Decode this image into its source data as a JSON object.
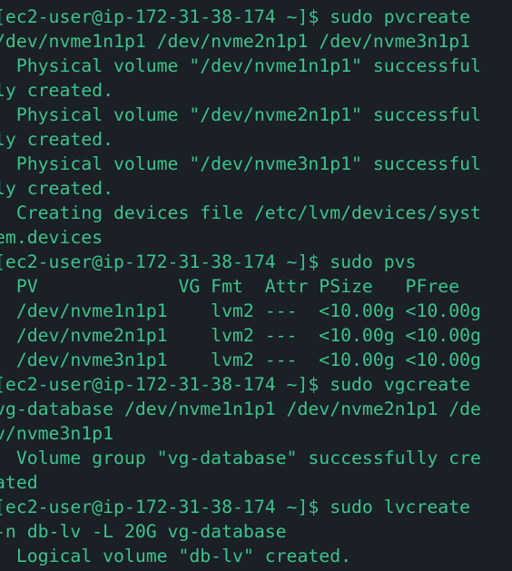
{
  "terminal": {
    "lines": [
      {
        "kind": "prompt",
        "text": "[ec2-user@ip-172-31-38-174 ~]$ sudo pvcreate"
      },
      {
        "kind": "continuation",
        "text": "/dev/nvme1n1p1 /dev/nvme2n1p1 /dev/nvme3n1p1"
      },
      {
        "kind": "output",
        "text": "  Physical volume \"/dev/nvme1n1p1\" successful"
      },
      {
        "kind": "continuation",
        "text": "ly created."
      },
      {
        "kind": "output",
        "text": "  Physical volume \"/dev/nvme2n1p1\" successful"
      },
      {
        "kind": "continuation",
        "text": "ly created."
      },
      {
        "kind": "output",
        "text": "  Physical volume \"/dev/nvme3n1p1\" successful"
      },
      {
        "kind": "continuation",
        "text": "ly created."
      },
      {
        "kind": "output",
        "text": "  Creating devices file /etc/lvm/devices/syst"
      },
      {
        "kind": "continuation",
        "text": "em.devices"
      },
      {
        "kind": "prompt",
        "text": "[ec2-user@ip-172-31-38-174 ~]$ sudo pvs"
      },
      {
        "kind": "table-head",
        "text": "  PV             VG Fmt  Attr PSize   PFree"
      },
      {
        "kind": "table-row",
        "text": "  /dev/nvme1n1p1    lvm2 ---  <10.00g <10.00g"
      },
      {
        "kind": "table-row",
        "text": "  /dev/nvme2n1p1    lvm2 ---  <10.00g <10.00g"
      },
      {
        "kind": "table-row",
        "text": "  /dev/nvme3n1p1    lvm2 ---  <10.00g <10.00g"
      },
      {
        "kind": "prompt",
        "text": "[ec2-user@ip-172-31-38-174 ~]$ sudo vgcreate"
      },
      {
        "kind": "continuation",
        "text": "vg-database /dev/nvme1n1p1 /dev/nvme2n1p1 /de"
      },
      {
        "kind": "continuation",
        "text": "v/nvme3n1p1"
      },
      {
        "kind": "output",
        "text": "  Volume group \"vg-database\" successfully cre"
      },
      {
        "kind": "continuation",
        "text": "ated"
      },
      {
        "kind": "prompt",
        "text": "[ec2-user@ip-172-31-38-174 ~]$ sudo lvcreate"
      },
      {
        "kind": "continuation",
        "text": "-n db-lv -L 20G vg-database"
      },
      {
        "kind": "output",
        "text": "  Logical volume \"db-lv\" created."
      }
    ]
  },
  "colors": {
    "background": "#1b1f26",
    "text": "#3bc48c"
  }
}
